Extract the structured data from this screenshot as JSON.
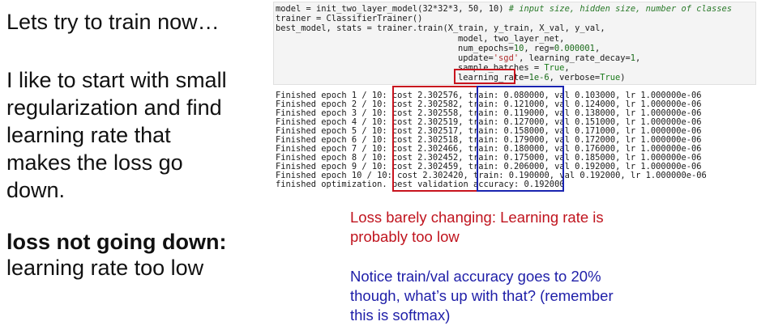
{
  "left": {
    "line1": "Lets try to train now…",
    "para": [
      "I like to start with small",
      "regularization and find",
      "learning rate that",
      "makes the loss go",
      "down."
    ],
    "bold_heading": "loss not going down:",
    "subline": "learning rate too low"
  },
  "code": {
    "l1_code": "model = init_two_layer_model(32*32*3, 50, 10) ",
    "l1_comment": "# input size, hidden size, number of classes",
    "l2": "trainer = ClassifierTrainer()",
    "l3": "best_model, stats = trainer.train(X_train, y_train, X_val, y_val,",
    "l4": "model, two_layer_net,",
    "l5_a": "num_epochs=",
    "l5_n1": "10",
    "l5_b": ", reg=",
    "l5_n2": "0.000001",
    "l5_c": ",",
    "l6_a": "update=",
    "l6_s": "'sgd'",
    "l6_b": ", learning_rate_decay=",
    "l6_n": "1",
    "l6_c": ",",
    "l7_a": "sample_batches = ",
    "l7_k": "True",
    "l7_b": ",",
    "l8_a": "learning_rate=",
    "l8_n": "1e-6",
    "l8_b": ", verbose=",
    "l8_k": "True",
    "l8_c": ")"
  },
  "log": [
    "Finished epoch 1 / 10: cost 2.302576, train: 0.080000, val 0.103000, lr 1.000000e-06",
    "Finished epoch 2 / 10: cost 2.302582, train: 0.121000, val 0.124000, lr 1.000000e-06",
    "Finished epoch 3 / 10: cost 2.302558, train: 0.119000, val 0.138000, lr 1.000000e-06",
    "Finished epoch 4 / 10: cost 2.302519, train: 0.127000, val 0.151000, lr 1.000000e-06",
    "Finished epoch 5 / 10: cost 2.302517, train: 0.158000, val 0.171000, lr 1.000000e-06",
    "Finished epoch 6 / 10: cost 2.302518, train: 0.179000, val 0.172000, lr 1.000000e-06",
    "Finished epoch 7 / 10: cost 2.302466, train: 0.180000, val 0.176000, lr 1.000000e-06",
    "Finished epoch 8 / 10: cost 2.302452, train: 0.175000, val 0.185000, lr 1.000000e-06",
    "Finished epoch 9 / 10: cost 2.302459, train: 0.206000, val 0.192000, lr 1.000000e-06",
    "Finished epoch 10 / 10: cost 2.302420, train: 0.190000, val 0.192000, lr 1.000000e-06",
    "finished optimization. best validation accuracy: 0.192000"
  ],
  "notes": {
    "red": [
      "Loss barely changing: Learning rate is",
      "probably too low"
    ],
    "blue": [
      "Notice train/val accuracy goes to 20%",
      "though, what’s up with that? (remember",
      "this is softmax)"
    ]
  },
  "colors": {
    "red": "#c0141e",
    "blue": "#1e1ea8",
    "box_red": "#c8141e",
    "box_blue": "#1a24b0"
  }
}
